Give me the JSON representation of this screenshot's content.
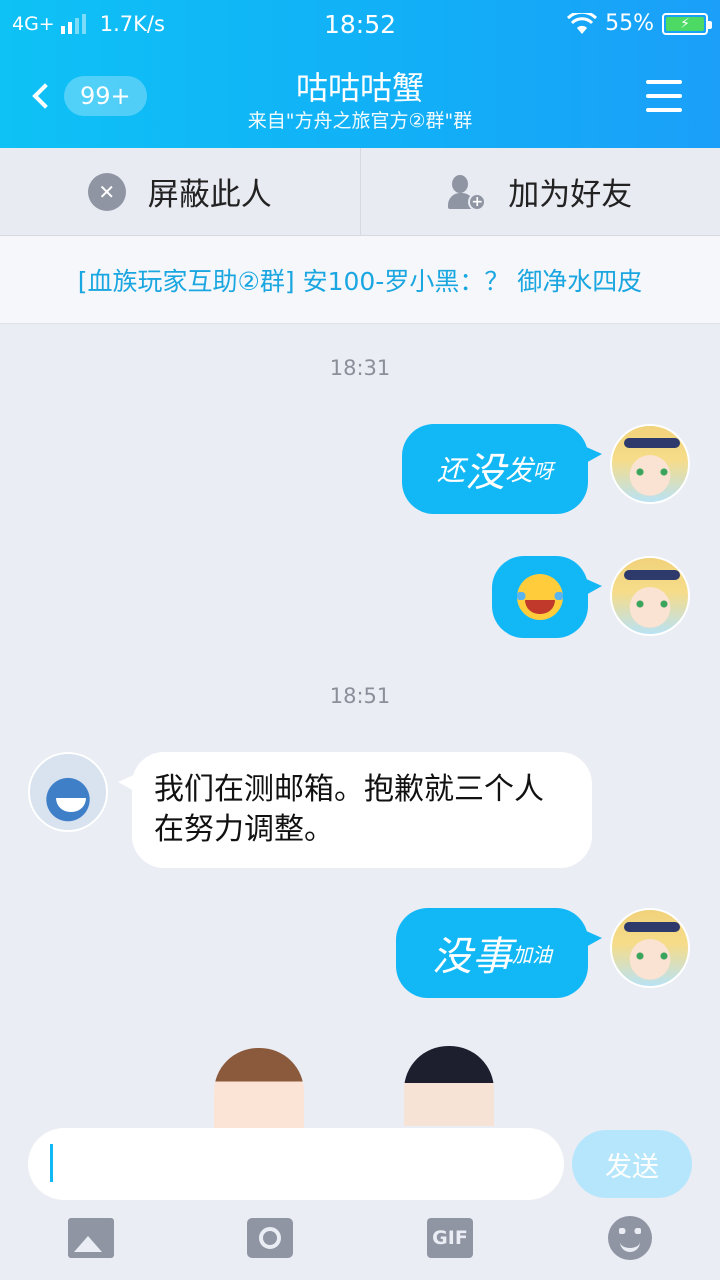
{
  "status_bar": {
    "network": "4G+",
    "speed": "1.7K/s",
    "time": "18:52",
    "battery": "55%",
    "charging_symbol": "⚡"
  },
  "nav": {
    "unread_badge": "99+",
    "title": "咕咕咕蟹",
    "subtitle": "来自\"方舟之旅官方②群\"群"
  },
  "actions": {
    "block_label": "屏蔽此人",
    "block_icon": "block-icon",
    "add_friend_label": "加为好友",
    "add_friend_icon": "add-friend-icon"
  },
  "notice": {
    "text": "[血族玩家互助②群] 安100-罗小黑：？ 御净水四皮"
  },
  "chat": {
    "timestamps": [
      "18:31",
      "18:51"
    ],
    "messages": [
      {
        "sender": "me",
        "type": "handwriting",
        "parts": [
          "还",
          "没",
          "发",
          "呀"
        ]
      },
      {
        "sender": "me",
        "type": "emoji",
        "emoji": "laughing-crying-emoji"
      },
      {
        "sender": "other",
        "type": "text",
        "text": "我们在测邮箱。抱歉就三个人在努力调整。"
      },
      {
        "sender": "me",
        "type": "handwriting",
        "parts": [
          "没",
          "事",
          "加油"
        ]
      }
    ]
  },
  "input": {
    "value": "",
    "send_label": "发送"
  },
  "toolbar": {
    "gif_label": "GIF",
    "icons": [
      "image-icon",
      "camera-icon",
      "gif-icon",
      "emoji-icon"
    ]
  },
  "colors": {
    "accent": "#12b7f5",
    "header_start": "#0ec2f5",
    "header_end": "#1b9ff9",
    "notice_text": "#1aa6e0",
    "background": "#eaedf4"
  }
}
